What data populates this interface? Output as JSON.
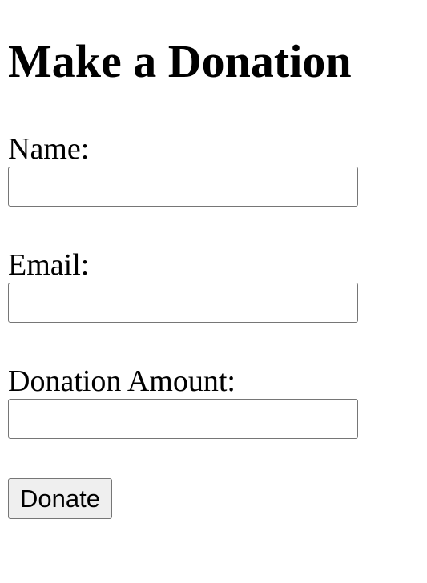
{
  "form": {
    "title": "Make a Donation",
    "name_label": "Name:",
    "name_value": "",
    "email_label": "Email:",
    "email_value": "",
    "amount_label": "Donation Amount:",
    "amount_value": "",
    "submit_label": "Donate"
  }
}
